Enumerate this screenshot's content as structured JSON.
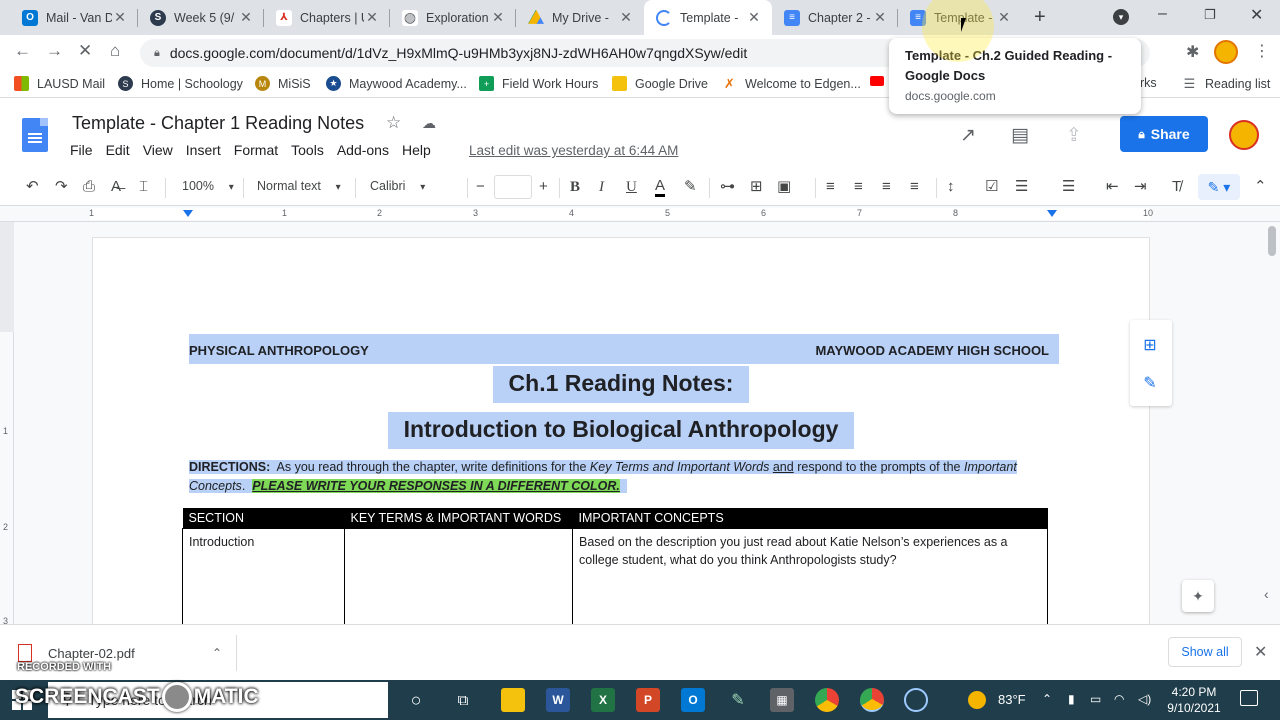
{
  "browser": {
    "tabs": [
      {
        "title": "Mail - Van D",
        "icon": "outlook-icon",
        "color": "#0078d4"
      },
      {
        "title": "Week 5 (9/",
        "icon": "schoology-icon",
        "color": "#2e3b4e"
      },
      {
        "title": "Chapters | U",
        "icon": "pdf-icon",
        "color": "#d93025"
      },
      {
        "title": "Exploration",
        "icon": "globe-icon",
        "color": "#5f6368"
      },
      {
        "title": "My Drive -",
        "icon": "drive-icon",
        "color": "#0f9d58"
      },
      {
        "title": "Template -",
        "icon": "loading-icon",
        "color": "#4285f4"
      },
      {
        "title": "Chapter 2 -",
        "icon": "docs-icon",
        "color": "#4285f4"
      },
      {
        "title": "Template -",
        "icon": "docs-icon",
        "color": "#4285f4"
      }
    ],
    "url": "docs.google.com/document/d/1dVz_H9xMlmQ-u9HMb3yxj8NJ-zdWH6AH0w7qngdXSyw/edit",
    "tooltip": {
      "title": "Template - Ch.2 Guided Reading - Google Docs",
      "url": "docs.google.com"
    },
    "bookmarks": [
      {
        "label": "LAUSD Mail",
        "icon": "windows-icon",
        "color": "#0078d4"
      },
      {
        "label": "Home | Schoology",
        "icon": "schoology-icon",
        "color": "#2e3b4e"
      },
      {
        "label": "MiSiS",
        "icon": "misis-icon",
        "color": "#b8860b"
      },
      {
        "label": "Maywood Academy...",
        "icon": "school-icon",
        "color": "#1a4d8f"
      },
      {
        "label": "Field Work Hours",
        "icon": "sheets-icon",
        "color": "#0f9d58"
      },
      {
        "label": "Google Drive",
        "icon": "folder-icon",
        "color": "#f4c20d"
      },
      {
        "label": "Welcome to Edgen...",
        "icon": "edgenuity-icon",
        "color": "#e8710a"
      },
      {
        "label": "rks",
        "icon": "folder-icon",
        "color": "#f4c20d"
      },
      {
        "label": "Reading list",
        "icon": "reading-list-icon",
        "color": "#5f6368"
      }
    ]
  },
  "docs": {
    "title": "Template - Chapter 1 Reading Notes",
    "menu": [
      "File",
      "Edit",
      "View",
      "Insert",
      "Format",
      "Tools",
      "Add-ons",
      "Help"
    ],
    "last_edit": "Last edit was yesterday at 6:44 AM",
    "share_label": "Share",
    "toolbar": {
      "zoom": "100%",
      "style": "Normal text",
      "font": "Calibri",
      "bold": "B",
      "italic": "I",
      "underline": "U",
      "text_color": "A"
    },
    "ruler_numbers": [
      "1",
      "1",
      "2",
      "3",
      "4",
      "5",
      "6",
      "7",
      "8",
      "10"
    ],
    "vruler_numbers": [
      "1",
      "2",
      "3"
    ]
  },
  "document": {
    "header_left": "PHYSICAL ANTHROPOLOGY",
    "header_right": "MAYWOOD ACADEMY HIGH SCHOOL",
    "heading1": "Ch.1 Reading Notes:",
    "heading2": "Introduction to Biological Anthropology",
    "directions": {
      "label": "DIRECTIONS:",
      "text1": "As you read through the chapter, write definitions for the",
      "key_terms": "Key Terms and Important Words",
      "and": "and",
      "text2": "respond to the prompts of the",
      "concepts": "Important Concepts",
      "period": ".",
      "emphasis": "PLEASE WRITE YOUR RESPONSES IN A DIFFERENT COLOR."
    },
    "table": {
      "headers": [
        "SECTION",
        "KEY TERMS & IMPORTANT WORDS",
        "IMPORTANT CONCEPTS"
      ],
      "rows": [
        {
          "section": "Introduction",
          "key_terms": "",
          "concepts": "Based on the description you just read about Katie Nelson’s experiences as a college student, what do you think Anthropologists study?"
        }
      ]
    }
  },
  "downloads": {
    "file": "Chapter-02.pdf",
    "show_all": "Show all"
  },
  "taskbar": {
    "search_placeholder": "Type here to search",
    "temperature": "83°F",
    "time": "4:20 PM",
    "date": "9/10/2021"
  },
  "watermark": {
    "recorded_with": "RECORDED WITH",
    "brand_a": "SCREENCAST",
    "brand_b": "MATIC"
  }
}
